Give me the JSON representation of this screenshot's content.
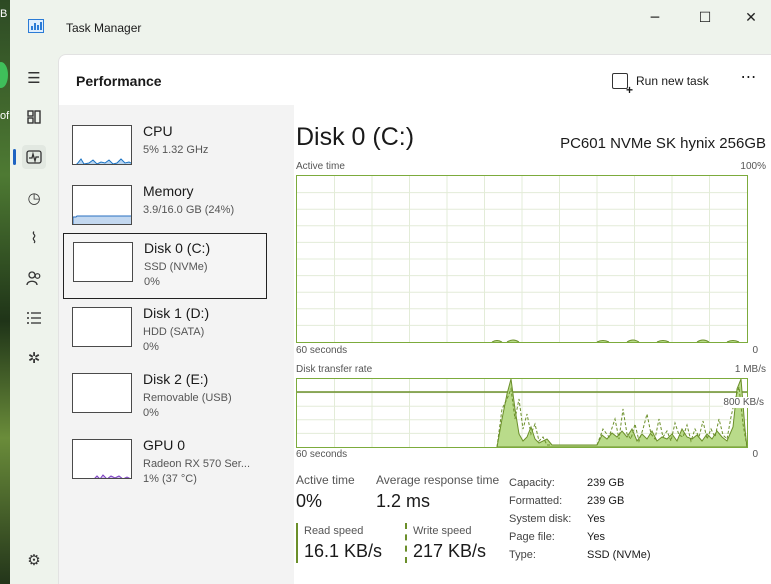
{
  "desktop": {
    "text_top": "B",
    "text_mid": "of"
  },
  "window": {
    "title": "Task Manager",
    "minimize": "─",
    "maximize": "☐",
    "close": "✕"
  },
  "header": {
    "title": "Performance",
    "run_new_task": "Run new task",
    "more": "⋯"
  },
  "nav_icons": [
    "hamburger-icon",
    "processes-icon",
    "performance-icon",
    "app-history-icon",
    "startup-apps-icon",
    "users-icon",
    "details-icon",
    "services-icon",
    "settings-icon"
  ],
  "devices": [
    {
      "name": "CPU",
      "sub1": "5%  1.32 GHz",
      "sub2": ""
    },
    {
      "name": "Memory",
      "sub1": "3.9/16.0 GB (24%)",
      "sub2": ""
    },
    {
      "name": "Disk 0 (C:)",
      "sub1": "SSD (NVMe)",
      "sub2": "0%"
    },
    {
      "name": "Disk 1 (D:)",
      "sub1": "HDD (SATA)",
      "sub2": "0%"
    },
    {
      "name": "Disk 2 (E:)",
      "sub1": "Removable (USB)",
      "sub2": "0%"
    },
    {
      "name": "GPU 0",
      "sub1": "Radeon RX 570 Ser...",
      "sub2": "1% (37 °C)"
    }
  ],
  "detail": {
    "title": "Disk 0 (C:)",
    "model": "PC601 NVMe SK hynix 256GB",
    "active_time_label": "Active time",
    "active_time_max": "100%",
    "active_time_xlabel": "60 seconds",
    "active_time_xmin": "0",
    "transfer_label": "Disk transfer rate",
    "transfer_max": "1 MB/s",
    "transfer_mark": "800 KB/s",
    "transfer_xlabel": "60 seconds",
    "transfer_xmin": "0"
  },
  "stats": {
    "active_time_label": "Active time",
    "active_time_value": "0%",
    "avg_response_label": "Average response time",
    "avg_response_value": "1.2 ms",
    "read_label": "Read speed",
    "read_value": "16.1 KB/s",
    "write_label": "Write speed",
    "write_value": "217 KB/s"
  },
  "properties": [
    {
      "key": "Capacity:",
      "value": "239 GB"
    },
    {
      "key": "Formatted:",
      "value": "239 GB"
    },
    {
      "key": "System disk:",
      "value": "Yes"
    },
    {
      "key": "Page file:",
      "value": "Yes"
    },
    {
      "key": "Type:",
      "value": "SSD (NVMe)"
    }
  ],
  "colors": {
    "accent": "#1f63c2",
    "disk_line": "#6b8f2a",
    "disk_fill": "#b9db8a",
    "cpu": "#1c74c4",
    "memory": "#2a6fc0",
    "gpu": "#7b3fc0"
  }
}
